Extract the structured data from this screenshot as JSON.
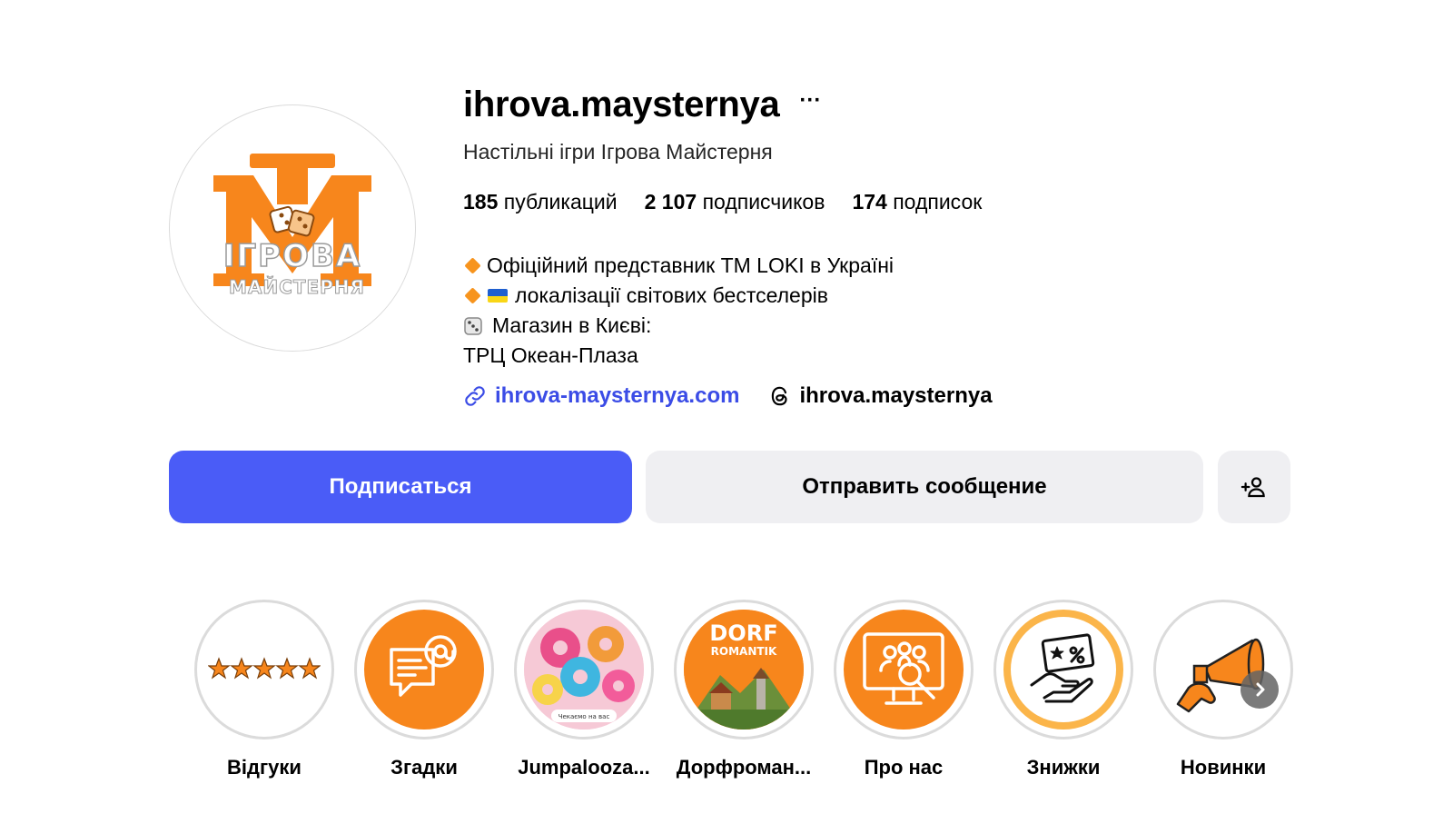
{
  "profile": {
    "username": "ihrova.maysternya",
    "more": "···",
    "full_name": "Настільні ігри Ігрова Майстерня",
    "logo_text_top": "ІГРОВА",
    "logo_text_bottom": "МАЙСТЕРНЯ"
  },
  "stats": {
    "posts_count": "185",
    "posts_label": "публикаций",
    "followers_count": "2 107",
    "followers_label": "подписчиков",
    "following_count": "174",
    "following_label": "подписок"
  },
  "bio": {
    "line1": "Офіційний представник ТМ LOKI в Україні",
    "line2": "локалізації світових бестселерів",
    "line3": "Магазин в Києві:",
    "line4": "ТРЦ Океан-Плаза"
  },
  "links": {
    "website": "ihrova-maysternya.com",
    "threads": "ihrova.maysternya"
  },
  "actions": {
    "follow": "Подписаться",
    "message": "Отправить сообщение"
  },
  "highlights": [
    {
      "label": "Відгуки",
      "icon": "five-stars-icon"
    },
    {
      "label": "Згадки",
      "icon": "chat-mention-icon"
    },
    {
      "label": "Jumpalooza...",
      "icon": "donuts-photo"
    },
    {
      "label": "Дорфроман...",
      "icon": "dorfromantik-cover"
    },
    {
      "label": "Про нас",
      "icon": "team-search-icon"
    },
    {
      "label": "Знижки",
      "icon": "discount-hand-icon"
    },
    {
      "label": "Новинки",
      "icon": "megaphone-icon"
    }
  ],
  "colors": {
    "brand_orange": "#f7861c",
    "follow_blue": "#4a5cf7",
    "link_blue": "#3b4ce6",
    "button_gray": "#efeff2"
  },
  "highlight_photo_texts": {
    "dorf_title": "DORF",
    "dorf_subtitle": "ROMANTIK",
    "donuts_caption": "Чекаємо на вас"
  }
}
